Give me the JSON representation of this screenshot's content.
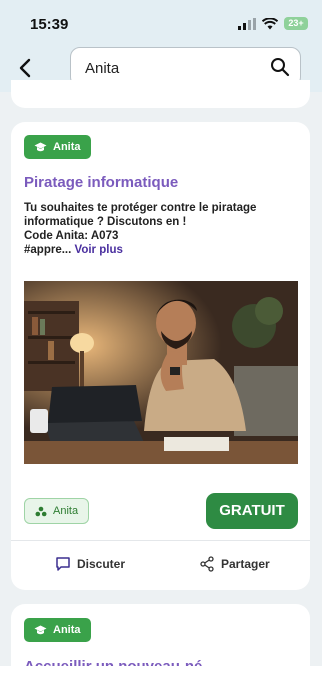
{
  "status_bar": {
    "time": "15:39",
    "battery": "23+"
  },
  "header": {
    "search_value": "Anita"
  },
  "card": {
    "badge_label": "Anita",
    "title": "Piratage informatique",
    "description_lines": [
      "Tu souhaites te protéger contre le piratage",
      "informatique ? Discutons en !",
      "Code Anita: A073",
      "#appre..."
    ],
    "see_more": "Voir plus",
    "owner_label": "Anita",
    "price_label": "GRATUIT",
    "actions": {
      "discuss": "Discuter",
      "share": "Partager"
    }
  },
  "next_card": {
    "badge_label": "Anita",
    "title": "Accueillir un nouveau-né"
  },
  "colors": {
    "accent_green": "#3aa24a",
    "title_purple": "#7b5bbd",
    "link_purple": "#4a2f9f"
  }
}
